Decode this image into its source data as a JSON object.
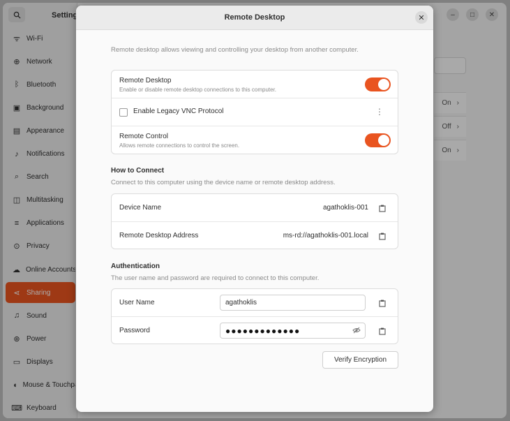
{
  "background_window": {
    "title": "Settings",
    "sidebar": [
      {
        "label": "Wi-Fi",
        "icon": "wifi-icon",
        "glyph": "ᯤ"
      },
      {
        "label": "Network",
        "icon": "network-icon",
        "glyph": "⊕"
      },
      {
        "label": "Bluetooth",
        "icon": "bluetooth-icon",
        "glyph": "ᛒ"
      },
      {
        "label": "Background",
        "icon": "background-icon",
        "glyph": "▣"
      },
      {
        "label": "Appearance",
        "icon": "appearance-icon",
        "glyph": "▤"
      },
      {
        "label": "Notifications",
        "icon": "bell-icon",
        "glyph": "♪"
      },
      {
        "label": "Search",
        "icon": "search-icon",
        "glyph": "⌕"
      },
      {
        "label": "Multitasking",
        "icon": "multitasking-icon",
        "glyph": "◫"
      },
      {
        "label": "Applications",
        "icon": "applications-icon",
        "glyph": "≡"
      },
      {
        "label": "Privacy",
        "icon": "privacy-icon",
        "glyph": "⊙"
      },
      {
        "label": "Online Accounts",
        "icon": "cloud-icon",
        "glyph": "☁"
      },
      {
        "label": "Sharing",
        "icon": "share-icon",
        "glyph": "⋖"
      },
      {
        "label": "Sound",
        "icon": "sound-icon",
        "glyph": "♫"
      },
      {
        "label": "Power",
        "icon": "power-icon",
        "glyph": "⊛"
      },
      {
        "label": "Displays",
        "icon": "display-icon",
        "glyph": "▭"
      },
      {
        "label": "Mouse & Touchpad",
        "icon": "mouse-icon",
        "glyph": "◖"
      },
      {
        "label": "Keyboard",
        "icon": "keyboard-icon",
        "glyph": "⌨"
      }
    ],
    "active_item": "Sharing",
    "right_rows": [
      "On",
      "Off",
      "On"
    ]
  },
  "dialog": {
    "title": "Remote Desktop",
    "intro": "Remote desktop allows viewing and controlling your desktop from another computer.",
    "remote_desktop": {
      "label": "Remote Desktop",
      "sublabel": "Enable or disable remote desktop connections to this computer.",
      "enabled": true
    },
    "legacy_vnc": {
      "label": "Enable Legacy VNC Protocol",
      "checked": false
    },
    "remote_control": {
      "label": "Remote Control",
      "sublabel": "Allows remote connections to control the screen.",
      "enabled": true
    },
    "how_to_connect": {
      "title": "How to Connect",
      "description": "Connect to this computer using the device name or remote desktop address.",
      "device_name_label": "Device Name",
      "device_name_value": "agathoklis-001",
      "address_label": "Remote Desktop Address",
      "address_value": "ms-rd://agathoklis-001.local"
    },
    "authentication": {
      "title": "Authentication",
      "description": "The user name and password are required to connect to this computer.",
      "username_label": "User Name",
      "username_value": "agathoklis",
      "password_label": "Password",
      "password_value": "●●●●●●●●●●●●●"
    },
    "verify_button": "Verify Encryption"
  },
  "colors": {
    "accent": "#e95420"
  }
}
